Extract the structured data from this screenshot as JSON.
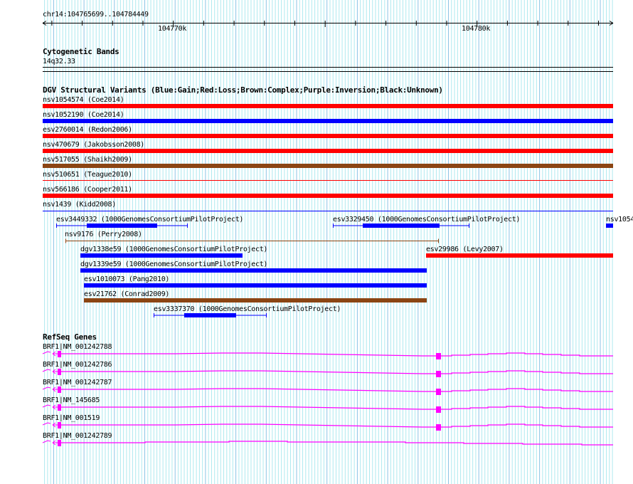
{
  "ruler": {
    "region": "chr14:104765699..104784449",
    "ticks": [
      "104770k",
      "104780k"
    ]
  },
  "cytoband": {
    "title": "Cytogenetic Bands",
    "band": "14q32.33"
  },
  "dgv": {
    "title": "DGV Structural Variants (Blue:Gain;Red:Loss;Brown:Complex;Purple:Inversion;Black:Unknown)",
    "colors": {
      "gain": "#0000ff",
      "loss": "#ff0000",
      "complex": "#8b4513"
    },
    "features": [
      {
        "label": "nsv1054574 (Coe2014)",
        "type": "loss"
      },
      {
        "label": "nsv1052190 (Coe2014)",
        "type": "gain"
      },
      {
        "label": "esv2760014 (Redon2006)",
        "type": "loss"
      },
      {
        "label": "nsv470679 (Jakobsson2008)",
        "type": "loss"
      },
      {
        "label": "nsv517055 (Shaikh2009)",
        "type": "complex"
      },
      {
        "label": "nsv510651 (Teague2010)",
        "type": "loss"
      },
      {
        "label": "nsv566186 (Cooper2011)",
        "type": "loss"
      },
      {
        "label": "nsv1439 (Kidd2008)",
        "type": "gain"
      },
      {
        "label": "esv3449332 (1000GenomesConsortiumPilotProject)",
        "type": "gain"
      },
      {
        "label": "esv3329450 (1000GenomesConsortiumPilotProject)",
        "type": "gain"
      },
      {
        "label": "nsv1054",
        "type": "gain"
      },
      {
        "label": "nsv9176 (Perry2008)",
        "type": "complex"
      },
      {
        "label": "dgv1338e59 (1000GenomesConsortiumPilotProject)",
        "type": "gain"
      },
      {
        "label": "esv29986 (Levy2007)",
        "type": "loss"
      },
      {
        "label": "dgv1339e59 (1000GenomesConsortiumPilotProject)",
        "type": "gain"
      },
      {
        "label": "esv1010073 (Pang2010)",
        "type": "gain"
      },
      {
        "label": "esv21762 (Conrad2009)",
        "type": "complex"
      },
      {
        "label": "esv3337370 (1000GenomesConsortiumPilotProject)",
        "type": "gain"
      }
    ]
  },
  "refseq": {
    "title": "RefSeq Genes",
    "color": "#ff00ff",
    "genes": [
      {
        "label": "BRF1|NM_001242788"
      },
      {
        "label": "BRF1|NM_001242786"
      },
      {
        "label": "BRF1|NM_001242787"
      },
      {
        "label": "BRF1|NM_145685"
      },
      {
        "label": "BRF1|NM_001519"
      },
      {
        "label": "BRF1|NM_001242789"
      }
    ]
  }
}
